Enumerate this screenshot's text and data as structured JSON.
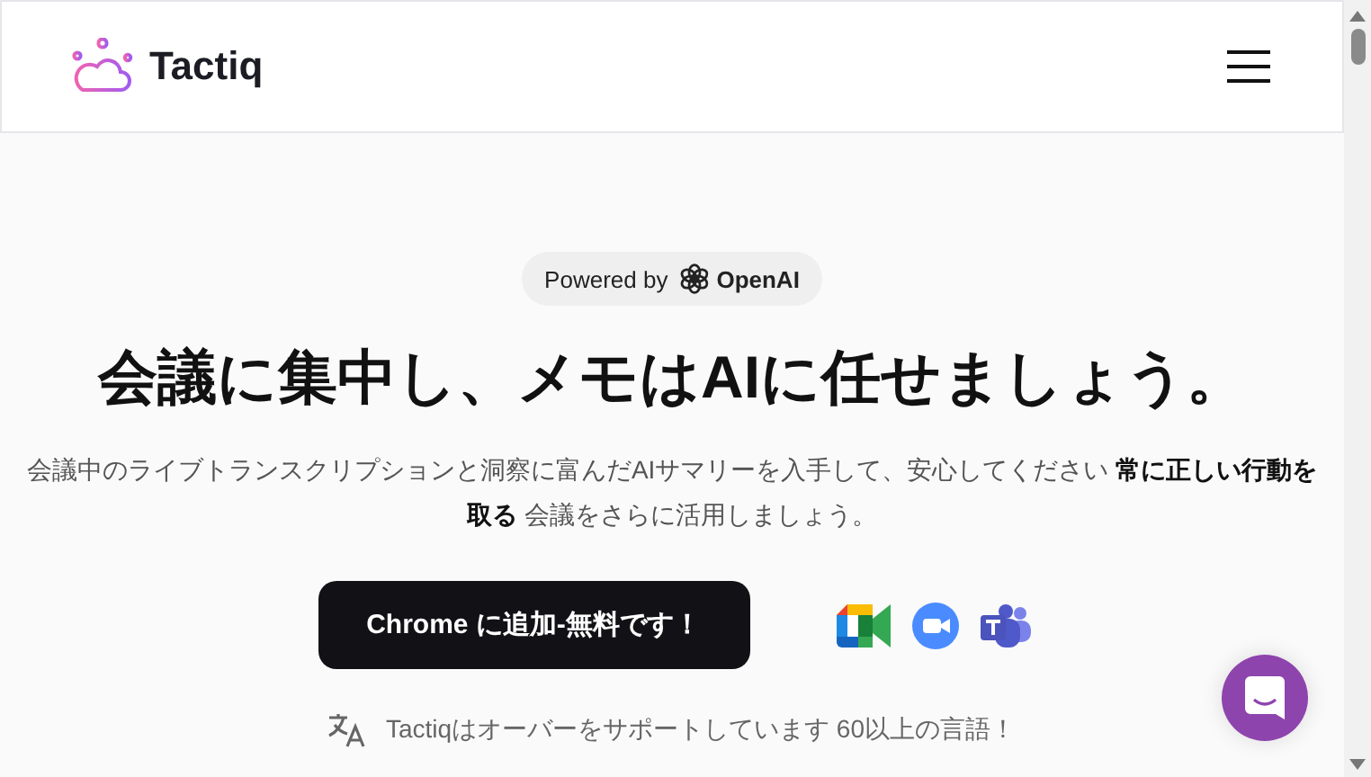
{
  "header": {
    "brand": "Tactiq"
  },
  "badge": {
    "prefix": "Powered by",
    "brand": "OpenAI"
  },
  "hero": {
    "title": "会議に集中し、メモはAIに任せましょう。",
    "subtitle": "会議中のライブトランスクリプションと洞察に富んだAIサマリーを入手して、安心してください **常に正しい行動を取る** 会議をさらに活用しましょう。"
  },
  "cta": {
    "label": "Chrome に追加-無料です！"
  },
  "languages": {
    "text": "Tactiqはオーバーをサポートしています 60以上の言語！"
  }
}
